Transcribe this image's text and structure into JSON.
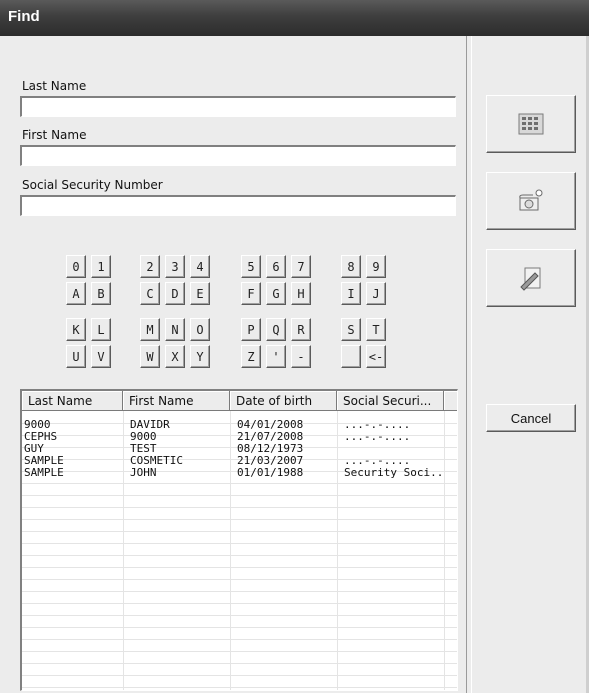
{
  "window": {
    "title": "Find"
  },
  "fields": {
    "last_name": {
      "label": "Last Name",
      "value": ""
    },
    "first_name": {
      "label": "First Name",
      "value": ""
    },
    "ssn": {
      "label": "Social Security Number",
      "value": ""
    }
  },
  "keypad": {
    "row1": [
      "0",
      "1",
      "2",
      "3",
      "4",
      "5",
      "6",
      "7",
      "8",
      "9"
    ],
    "row2": [
      "A",
      "B",
      "C",
      "D",
      "E",
      "F",
      "G",
      "H",
      "I",
      "J"
    ],
    "row3": [
      "K",
      "L",
      "M",
      "N",
      "O",
      "P",
      "Q",
      "R",
      "S",
      "T"
    ],
    "row4": [
      "U",
      "V",
      "W",
      "X",
      "Y",
      "Z",
      "'",
      "-",
      " ",
      "<-"
    ]
  },
  "table": {
    "columns": [
      "Last Name",
      "First Name",
      "Date of birth",
      "Social Securi..."
    ],
    "rows": [
      [
        "9000",
        "DAVIDR",
        "04/01/2008",
        "...-.-...."
      ],
      [
        "CEPHS",
        "9000",
        "21/07/2008",
        "...-.-...."
      ],
      [
        "GUY",
        "TEST",
        "08/12/1973",
        ""
      ],
      [
        "SAMPLE",
        "COSMETIC",
        "21/03/2007",
        "...-.-...."
      ],
      [
        "SAMPLE",
        "JOHN",
        "01/01/1988",
        "Security Soci..."
      ]
    ]
  },
  "buttons": {
    "cancel_label": "Cancel",
    "icons": [
      "keypad-icon",
      "camera-icon",
      "edit-icon"
    ]
  }
}
